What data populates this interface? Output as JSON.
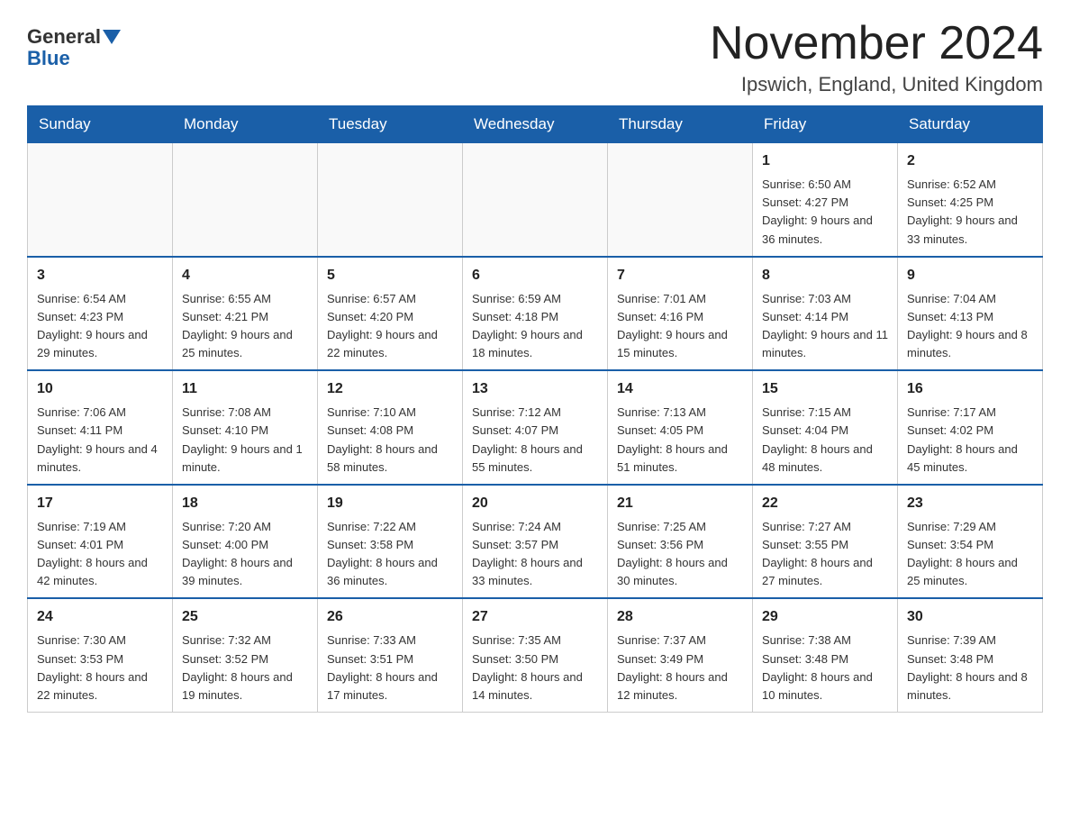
{
  "header": {
    "logo_general": "General",
    "logo_blue": "Blue",
    "month_year": "November 2024",
    "location": "Ipswich, England, United Kingdom"
  },
  "days_of_week": [
    "Sunday",
    "Monday",
    "Tuesday",
    "Wednesday",
    "Thursday",
    "Friday",
    "Saturday"
  ],
  "weeks": [
    {
      "days": [
        {
          "num": "",
          "info": ""
        },
        {
          "num": "",
          "info": ""
        },
        {
          "num": "",
          "info": ""
        },
        {
          "num": "",
          "info": ""
        },
        {
          "num": "",
          "info": ""
        },
        {
          "num": "1",
          "info": "Sunrise: 6:50 AM\nSunset: 4:27 PM\nDaylight: 9 hours and 36 minutes."
        },
        {
          "num": "2",
          "info": "Sunrise: 6:52 AM\nSunset: 4:25 PM\nDaylight: 9 hours and 33 minutes."
        }
      ]
    },
    {
      "days": [
        {
          "num": "3",
          "info": "Sunrise: 6:54 AM\nSunset: 4:23 PM\nDaylight: 9 hours and 29 minutes."
        },
        {
          "num": "4",
          "info": "Sunrise: 6:55 AM\nSunset: 4:21 PM\nDaylight: 9 hours and 25 minutes."
        },
        {
          "num": "5",
          "info": "Sunrise: 6:57 AM\nSunset: 4:20 PM\nDaylight: 9 hours and 22 minutes."
        },
        {
          "num": "6",
          "info": "Sunrise: 6:59 AM\nSunset: 4:18 PM\nDaylight: 9 hours and 18 minutes."
        },
        {
          "num": "7",
          "info": "Sunrise: 7:01 AM\nSunset: 4:16 PM\nDaylight: 9 hours and 15 minutes."
        },
        {
          "num": "8",
          "info": "Sunrise: 7:03 AM\nSunset: 4:14 PM\nDaylight: 9 hours and 11 minutes."
        },
        {
          "num": "9",
          "info": "Sunrise: 7:04 AM\nSunset: 4:13 PM\nDaylight: 9 hours and 8 minutes."
        }
      ]
    },
    {
      "days": [
        {
          "num": "10",
          "info": "Sunrise: 7:06 AM\nSunset: 4:11 PM\nDaylight: 9 hours and 4 minutes."
        },
        {
          "num": "11",
          "info": "Sunrise: 7:08 AM\nSunset: 4:10 PM\nDaylight: 9 hours and 1 minute."
        },
        {
          "num": "12",
          "info": "Sunrise: 7:10 AM\nSunset: 4:08 PM\nDaylight: 8 hours and 58 minutes."
        },
        {
          "num": "13",
          "info": "Sunrise: 7:12 AM\nSunset: 4:07 PM\nDaylight: 8 hours and 55 minutes."
        },
        {
          "num": "14",
          "info": "Sunrise: 7:13 AM\nSunset: 4:05 PM\nDaylight: 8 hours and 51 minutes."
        },
        {
          "num": "15",
          "info": "Sunrise: 7:15 AM\nSunset: 4:04 PM\nDaylight: 8 hours and 48 minutes."
        },
        {
          "num": "16",
          "info": "Sunrise: 7:17 AM\nSunset: 4:02 PM\nDaylight: 8 hours and 45 minutes."
        }
      ]
    },
    {
      "days": [
        {
          "num": "17",
          "info": "Sunrise: 7:19 AM\nSunset: 4:01 PM\nDaylight: 8 hours and 42 minutes."
        },
        {
          "num": "18",
          "info": "Sunrise: 7:20 AM\nSunset: 4:00 PM\nDaylight: 8 hours and 39 minutes."
        },
        {
          "num": "19",
          "info": "Sunrise: 7:22 AM\nSunset: 3:58 PM\nDaylight: 8 hours and 36 minutes."
        },
        {
          "num": "20",
          "info": "Sunrise: 7:24 AM\nSunset: 3:57 PM\nDaylight: 8 hours and 33 minutes."
        },
        {
          "num": "21",
          "info": "Sunrise: 7:25 AM\nSunset: 3:56 PM\nDaylight: 8 hours and 30 minutes."
        },
        {
          "num": "22",
          "info": "Sunrise: 7:27 AM\nSunset: 3:55 PM\nDaylight: 8 hours and 27 minutes."
        },
        {
          "num": "23",
          "info": "Sunrise: 7:29 AM\nSunset: 3:54 PM\nDaylight: 8 hours and 25 minutes."
        }
      ]
    },
    {
      "days": [
        {
          "num": "24",
          "info": "Sunrise: 7:30 AM\nSunset: 3:53 PM\nDaylight: 8 hours and 22 minutes."
        },
        {
          "num": "25",
          "info": "Sunrise: 7:32 AM\nSunset: 3:52 PM\nDaylight: 8 hours and 19 minutes."
        },
        {
          "num": "26",
          "info": "Sunrise: 7:33 AM\nSunset: 3:51 PM\nDaylight: 8 hours and 17 minutes."
        },
        {
          "num": "27",
          "info": "Sunrise: 7:35 AM\nSunset: 3:50 PM\nDaylight: 8 hours and 14 minutes."
        },
        {
          "num": "28",
          "info": "Sunrise: 7:37 AM\nSunset: 3:49 PM\nDaylight: 8 hours and 12 minutes."
        },
        {
          "num": "29",
          "info": "Sunrise: 7:38 AM\nSunset: 3:48 PM\nDaylight: 8 hours and 10 minutes."
        },
        {
          "num": "30",
          "info": "Sunrise: 7:39 AM\nSunset: 3:48 PM\nDaylight: 8 hours and 8 minutes."
        }
      ]
    }
  ]
}
